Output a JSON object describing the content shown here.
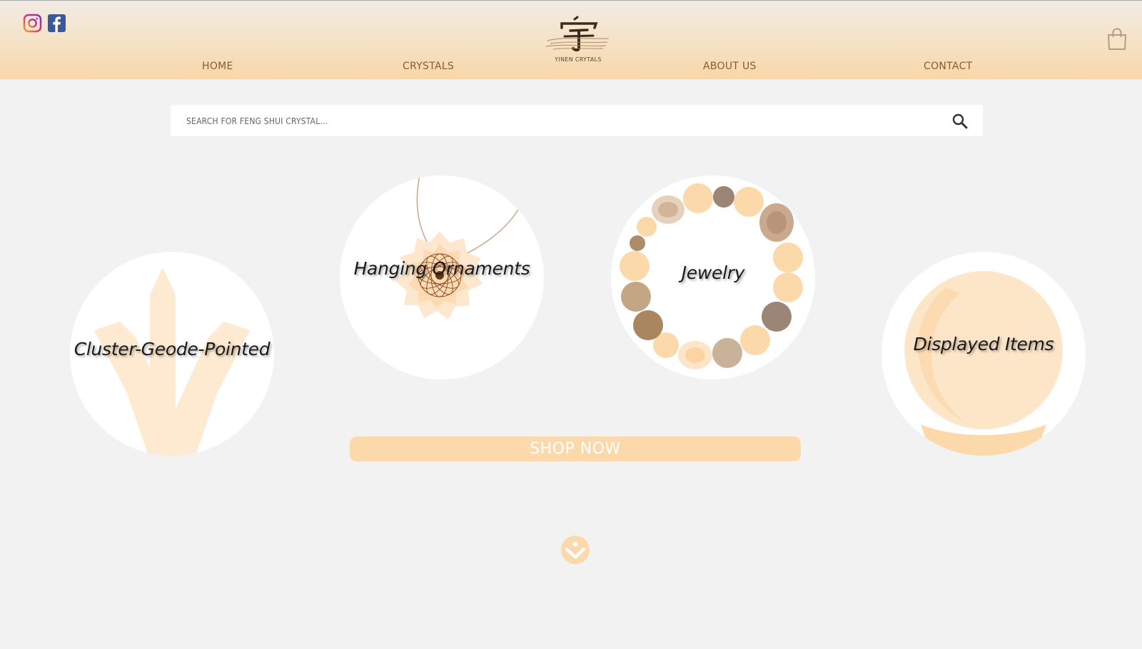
{
  "header": {
    "nav": {
      "home": "HOME",
      "crystals": "CRYSTALS",
      "about": "ABOUT US",
      "contact": "CONTACT"
    },
    "logo_text": "YINEN CRYTALS",
    "icons": {
      "instagram": "instagram-icon",
      "facebook": "facebook-icon",
      "cart": "shopping-bag-icon"
    }
  },
  "search": {
    "placeholder": "SEARCH FOR FENG SHUI CRYSTAL...",
    "value": "",
    "icon": "search-icon"
  },
  "categories": [
    {
      "label": "Cluster-Geode-Pointed"
    },
    {
      "label": "Hanging Ornaments"
    },
    {
      "label": "Jewelry"
    },
    {
      "label": "Displayed Items"
    }
  ],
  "shop_button": "SHOP NOW",
  "colors": {
    "accent": "#fbd9ab",
    "nav_text": "#8a5a2e",
    "background": "#f2f2f2"
  }
}
